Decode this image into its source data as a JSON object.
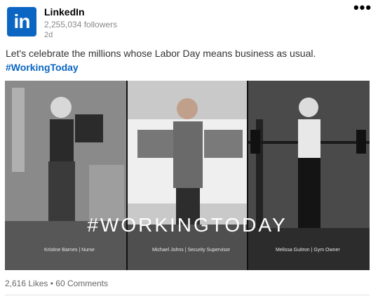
{
  "post": {
    "author": "LinkedIn",
    "followers": "2,255,034 followers",
    "time": "2d",
    "text": "Let's celebrate the millions whose Labor Day means business as usual.",
    "hashtag": "#WorkingToday",
    "logo_text": "in",
    "brand_color": "#0a66c2"
  },
  "image": {
    "headline": "#WORKINGTODAY",
    "captions": [
      "Kristine Barnes | Nurse",
      "Michael Johns | Security Supervisor",
      "Melissa Guitron | Gym Owner"
    ]
  },
  "stats": {
    "likes": "2,616 Likes",
    "separator": "•",
    "comments": "60 Comments"
  },
  "icons": {
    "more": "more-horizontal-icon"
  }
}
